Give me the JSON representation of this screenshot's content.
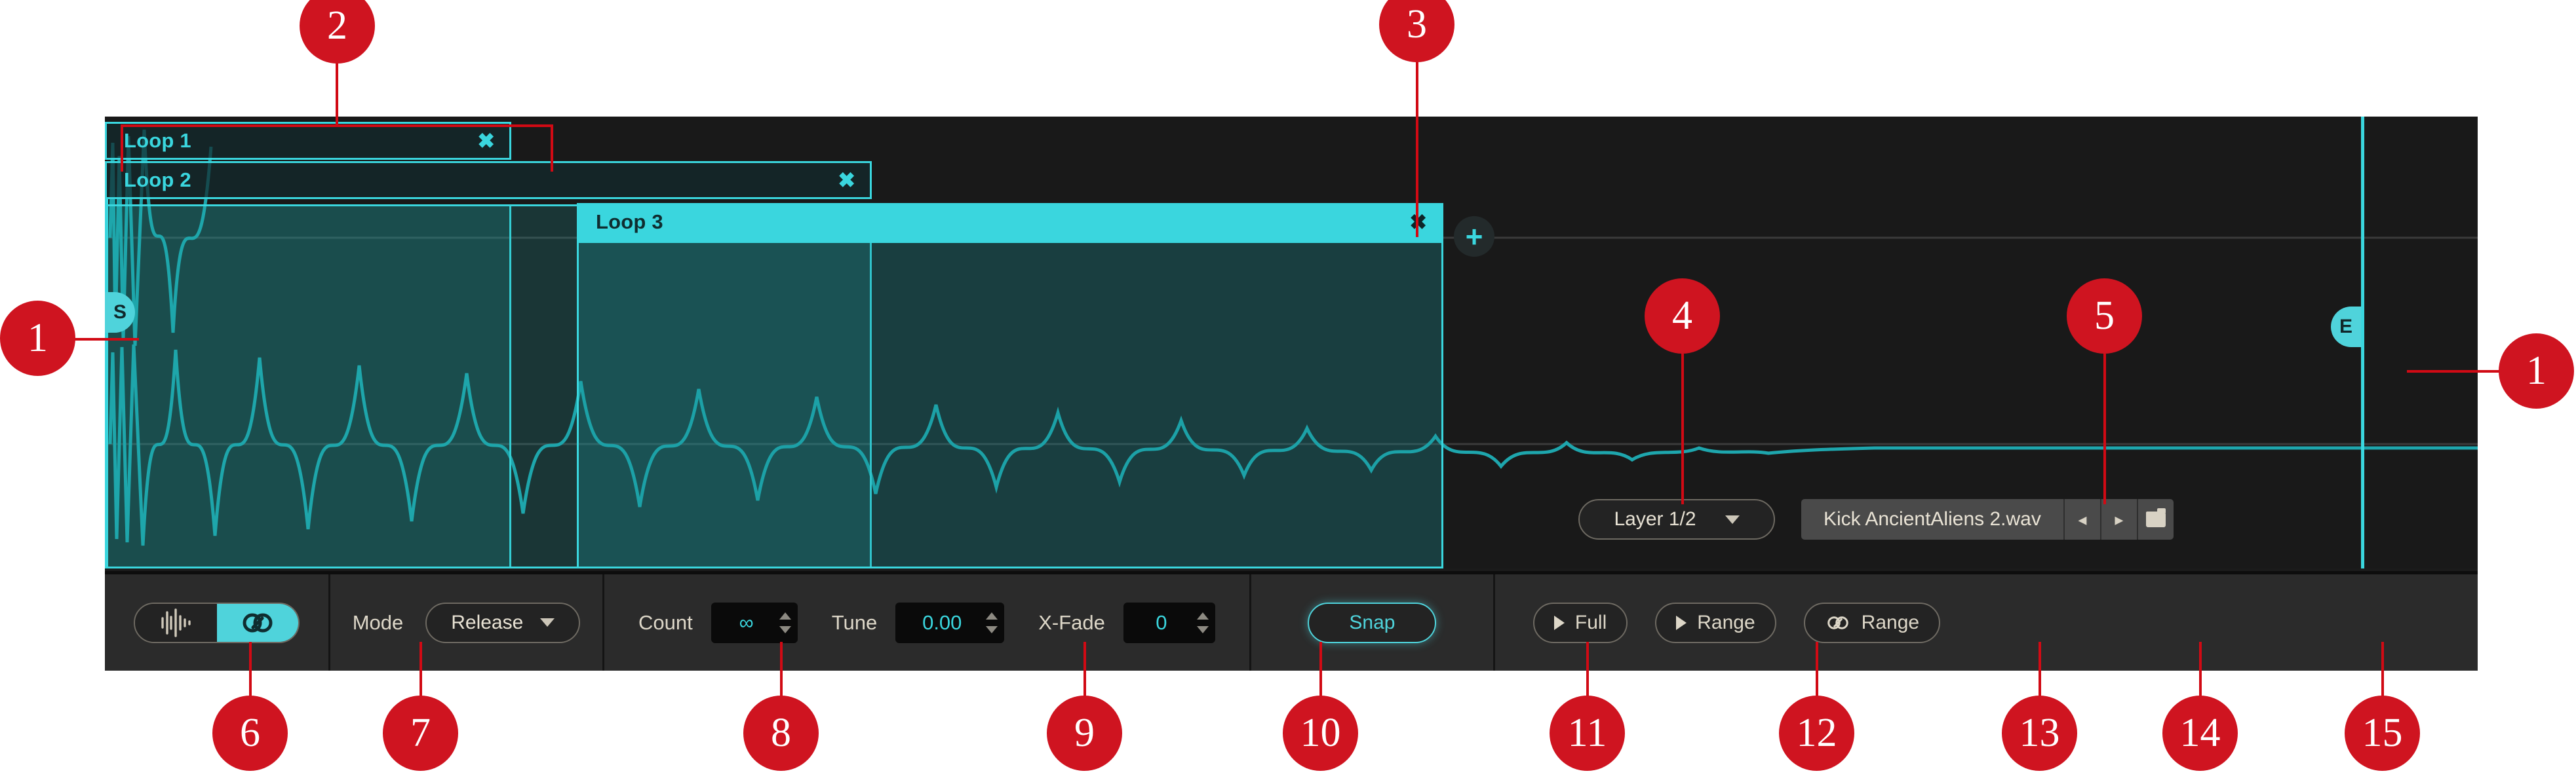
{
  "panel": {
    "loops": [
      {
        "name": "Loop 1",
        "close": "✖",
        "active": false
      },
      {
        "name": "Loop 2",
        "close": "✖",
        "active": false
      },
      {
        "name": "Loop 3",
        "close": "✖",
        "active": true
      }
    ],
    "markers": {
      "start": "S",
      "end": "E"
    },
    "add_button": "+",
    "layer_select": {
      "value": "Layer 1/2"
    },
    "file_browser": {
      "filename": "Kick AncientAliens 2.wav",
      "prev": "◂",
      "next": "▸",
      "folder_icon": "folder-icon"
    }
  },
  "toolbar": {
    "view_toggle": {
      "waveform_icon": "waveform-icon",
      "loop_icon": "loop-icon",
      "active": "loop"
    },
    "mode": {
      "label": "Mode",
      "value": "Release"
    },
    "count": {
      "label": "Count",
      "value": "∞"
    },
    "tune": {
      "label": "Tune",
      "value": "0.00"
    },
    "xfade": {
      "label": "X-Fade",
      "value": "0"
    },
    "snap": {
      "label": "Snap",
      "active": true
    },
    "play_full": {
      "label": "Full"
    },
    "play_range": {
      "label": "Range"
    },
    "loop_range": {
      "label": "Range"
    }
  },
  "callouts": [
    {
      "n": "1"
    },
    {
      "n": "2"
    },
    {
      "n": "3"
    },
    {
      "n": "4"
    },
    {
      "n": "5"
    },
    {
      "n": "1"
    },
    {
      "n": "6"
    },
    {
      "n": "7"
    },
    {
      "n": "8"
    },
    {
      "n": "9"
    },
    {
      "n": "10"
    },
    {
      "n": "11"
    },
    {
      "n": "12"
    },
    {
      "n": "13"
    },
    {
      "n": "14"
    },
    {
      "n": "15"
    }
  ],
  "colors": {
    "accent_teal": "#3ad6de",
    "accent_teal_bright": "#4fd3db",
    "callout_red": "#cf1420",
    "panel_bg": "#191919",
    "toolbar_bg": "#2b2b2b",
    "text_cream": "#ddd7c8"
  }
}
